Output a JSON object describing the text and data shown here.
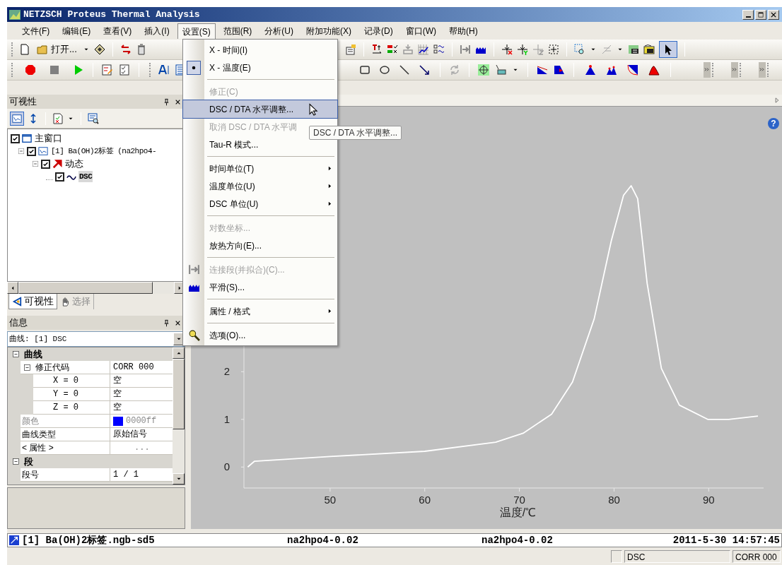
{
  "window": {
    "title": "NETZSCH Proteus Thermal Analysis"
  },
  "menu_bar": [
    {
      "label": "文件(F)",
      "selected": false
    },
    {
      "label": "编辑(E)",
      "selected": false
    },
    {
      "label": "查看(V)",
      "selected": false
    },
    {
      "label": "插入(I)",
      "selected": false
    },
    {
      "label": "设置(S)",
      "selected": true
    },
    {
      "label": "范围(R)",
      "selected": false
    },
    {
      "label": "分析(U)",
      "selected": false
    },
    {
      "label": "附加功能(X)",
      "selected": false
    },
    {
      "label": "记录(D)",
      "selected": false
    },
    {
      "label": "窗口(W)",
      "selected": false
    },
    {
      "label": "帮助(H)",
      "selected": false
    }
  ],
  "toolbar": {
    "open_label": "打开...",
    "pointer_selected": true
  },
  "open_menu": {
    "items": [
      {
        "kind": "radio",
        "label": "X - 时间(I)",
        "checked": false,
        "disabled": false,
        "submenu": false,
        "selected": false
      },
      {
        "kind": "radio",
        "label": "X - 温度(E)",
        "checked": true,
        "disabled": false,
        "submenu": false,
        "selected": false
      },
      {
        "kind": "separator"
      },
      {
        "kind": "item",
        "label": "修正(C)",
        "disabled": true,
        "submenu": false,
        "selected": false
      },
      {
        "kind": "item",
        "label": "DSC / DTA 水平调整...",
        "disabled": false,
        "submenu": false,
        "selected": true
      },
      {
        "kind": "item",
        "label": "取消 DSC / DTA 水平调",
        "disabled": true,
        "submenu": false,
        "selected": false
      },
      {
        "kind": "item",
        "label": "Tau-R 模式...",
        "disabled": false,
        "submenu": false,
        "selected": false
      },
      {
        "kind": "separator"
      },
      {
        "kind": "item",
        "label": "时间单位(T)",
        "disabled": false,
        "submenu": true,
        "selected": false
      },
      {
        "kind": "item",
        "label": "温度单位(U)",
        "disabled": false,
        "submenu": true,
        "selected": false
      },
      {
        "kind": "item",
        "label": "DSC 单位(U)",
        "disabled": false,
        "submenu": true,
        "selected": false
      },
      {
        "kind": "separator"
      },
      {
        "kind": "item",
        "label": "对数坐标...",
        "disabled": true,
        "submenu": false,
        "selected": false
      },
      {
        "kind": "item",
        "label": "放热方向(E)...",
        "disabled": false,
        "submenu": false,
        "selected": false
      },
      {
        "kind": "separator"
      },
      {
        "kind": "item",
        "label": "连接段(并拟合)(C)...",
        "disabled": true,
        "submenu": false,
        "selected": false
      },
      {
        "kind": "item",
        "label": "平滑(S)...",
        "disabled": false,
        "submenu": false,
        "selected": false
      },
      {
        "kind": "separator"
      },
      {
        "kind": "item",
        "label": "属性 / 格式",
        "disabled": false,
        "submenu": true,
        "selected": false
      },
      {
        "kind": "separator"
      },
      {
        "kind": "item",
        "label": "选项(O)...",
        "disabled": false,
        "submenu": false,
        "selected": false
      }
    ]
  },
  "tooltip": "DSC / DTA 水平调整...",
  "visibility_panel": {
    "title": "可视性",
    "tree": [
      {
        "label": "主窗口",
        "checked": true,
        "selected": false,
        "children": [
          {
            "label": "[1] Ba(OH)2标签 (na2hpo4-",
            "checked": true,
            "selected": false,
            "expanded": true,
            "children": [
              {
                "label": "动态",
                "checked": true,
                "selected": false,
                "expanded": true,
                "children": [
                  {
                    "label": "DSC",
                    "checked": true,
                    "selected": true
                  }
                ]
              }
            ]
          }
        ]
      }
    ],
    "tabs": [
      {
        "label": "可视性",
        "selected": true
      },
      {
        "label": "选择",
        "selected": false
      }
    ]
  },
  "info_panel": {
    "title": "信息",
    "selector": "曲线: [1] DSC",
    "properties": [
      {
        "kind": "category",
        "label": "曲线",
        "expanded": true,
        "children": [
          {
            "kind": "property",
            "label": "修正代码",
            "value": "CORR 000",
            "disabled": false,
            "expanded": true,
            "children": [
              {
                "kind": "property",
                "label": "X = 0",
                "value": "空",
                "disabled": false
              },
              {
                "kind": "property",
                "label": "Y = 0",
                "value": "空",
                "disabled": false
              },
              {
                "kind": "property",
                "label": "Z = 0",
                "value": "空",
                "disabled": false
              }
            ]
          },
          {
            "kind": "property",
            "label": "颜色",
            "value": "0000ff",
            "color": "#0000ff",
            "disabled": true
          },
          {
            "kind": "property",
            "label": "曲线类型",
            "value": "原始信号",
            "disabled": false
          },
          {
            "kind": "property",
            "label": "< 属性 >",
            "value": "...",
            "disabled": false
          }
        ]
      },
      {
        "kind": "category",
        "label": "段",
        "expanded": true,
        "children": [
          {
            "kind": "property",
            "label": "段号",
            "value": "1 / 1",
            "disabled": false
          }
        ]
      }
    ]
  },
  "chart": {
    "help_glyph": "?",
    "chart_data": {
      "type": "line",
      "xlabel": "温度/℃",
      "xlim": [
        40.9,
        95.8
      ],
      "ylim": [
        -0.44,
        7.56
      ],
      "xticks": [
        50,
        60,
        70,
        80,
        90
      ],
      "yticks": [
        0,
        1,
        2
      ],
      "x": [
        41.3,
        42,
        50,
        60,
        67.5,
        70.4,
        73.4,
        75.6,
        77.9,
        79.7,
        81,
        81.8,
        82.5,
        83.5,
        85,
        86.9,
        89.9,
        92.1,
        95.2
      ],
      "series": [
        {
          "color": "#ffffff",
          "values": [
            0,
            0.12,
            0.22,
            0.33,
            0.52,
            0.71,
            1.11,
            1.78,
            3.11,
            4.74,
            5.7,
            5.9,
            5.63,
            3.85,
            2.07,
            1.3,
            1.0,
            1.0,
            1.07
          ]
        }
      ]
    }
  },
  "document_bar": [
    "[1] Ba(OH)2标签.ngb-sd5",
    "na2hpo4-0.02",
    "na2hpo4-0.02",
    "2011-5-30 14:57:45"
  ],
  "status_bar": [
    "DSC",
    "CORR 000"
  ]
}
